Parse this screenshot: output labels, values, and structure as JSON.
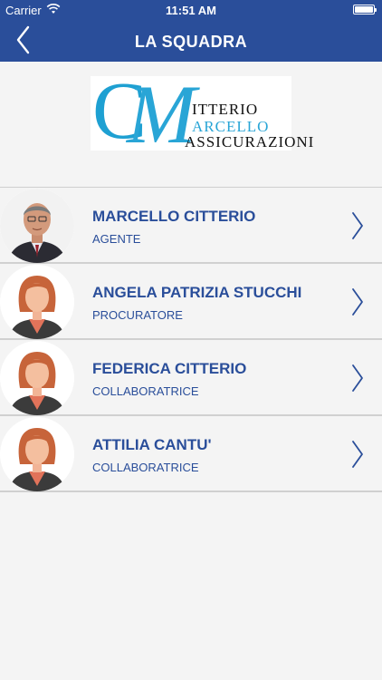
{
  "status_bar": {
    "carrier": "Carrier",
    "time": "11:51 AM",
    "wifi_icon": "wifi-icon",
    "battery_icon": "battery-icon"
  },
  "nav": {
    "title": "LA SQUADRA",
    "back_icon": "chevron-left-icon"
  },
  "logo": {
    "monogram_c": "C",
    "monogram_m": "M",
    "line1": "ITTERIO",
    "line2": "ARCELLO",
    "line3": "ASSICURAZIONI"
  },
  "team": [
    {
      "name": "MARCELLO CITTERIO",
      "role": "AGENTE",
      "avatar": "male-portrait"
    },
    {
      "name": "ANGELA PATRIZIA STUCCHI",
      "role": "PROCURATORE",
      "avatar": "female-avatar"
    },
    {
      "name": "FEDERICA CITTERIO",
      "role": "COLLABORATRICE",
      "avatar": "female-avatar"
    },
    {
      "name": "ATTILIA CANTU'",
      "role": "COLLABORATRICE",
      "avatar": "female-avatar"
    }
  ],
  "colors": {
    "brand": "#2a4e9a",
    "logo_accent": "#29a5d6"
  }
}
